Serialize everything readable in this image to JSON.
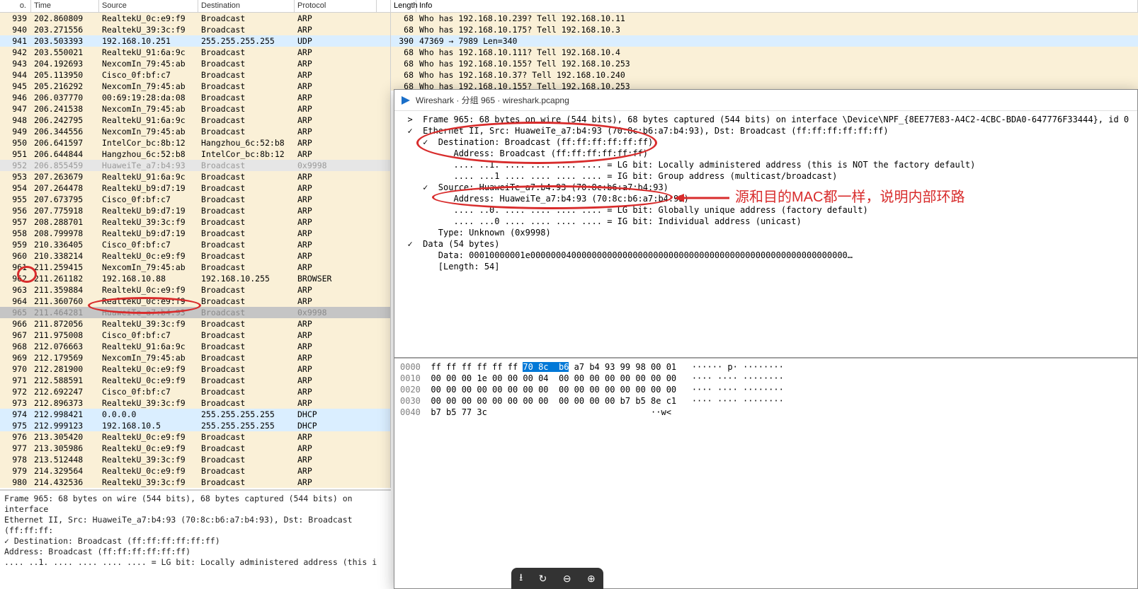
{
  "headers": {
    "no": "o.",
    "time": "Time",
    "src": "Source",
    "dst": "Destination",
    "proto": "Protocol",
    "len": "Length",
    "info": "Info"
  },
  "packets": [
    {
      "no": "939",
      "time": "202.860809",
      "src": "RealtekU_0c:e9:f9",
      "dst": "Broadcast",
      "proto": "ARP",
      "len": "68",
      "info": "Who has 192.168.10.239? Tell 192.168.10.11",
      "bg": "arp"
    },
    {
      "no": "940",
      "time": "203.271556",
      "src": "RealtekU_39:3c:f9",
      "dst": "Broadcast",
      "proto": "ARP",
      "len": "68",
      "info": "Who has 192.168.10.175? Tell 192.168.10.3",
      "bg": "arp"
    },
    {
      "no": "941",
      "time": "203.503393",
      "src": "192.168.10.251",
      "dst": "255.255.255.255",
      "proto": "UDP",
      "len": "390",
      "info": "47369 → 7989 Len=340",
      "bg": "udp"
    },
    {
      "no": "942",
      "time": "203.550021",
      "src": "RealtekU_91:6a:9c",
      "dst": "Broadcast",
      "proto": "ARP",
      "len": "68",
      "info": "Who has 192.168.10.111? Tell 192.168.10.4",
      "bg": "arp"
    },
    {
      "no": "943",
      "time": "204.192693",
      "src": "NexcomIn_79:45:ab",
      "dst": "Broadcast",
      "proto": "ARP",
      "len": "68",
      "info": "Who has 192.168.10.155? Tell 192.168.10.253",
      "bg": "arp"
    },
    {
      "no": "944",
      "time": "205.113950",
      "src": "Cisco_0f:bf:c7",
      "dst": "Broadcast",
      "proto": "ARP",
      "len": "68",
      "info": "Who has 192.168.10.37? Tell 192.168.10.240",
      "bg": "arp"
    },
    {
      "no": "945",
      "time": "205.216292",
      "src": "NexcomIn_79:45:ab",
      "dst": "Broadcast",
      "proto": "ARP",
      "len": "68",
      "info": "Who has 192.168.10.155? Tell 192.168.10.253",
      "bg": "arp"
    },
    {
      "no": "946",
      "time": "206.037770",
      "src": "00:69:19:28:da:08",
      "dst": "Broadcast",
      "proto": "ARP",
      "len": "",
      "info": "",
      "bg": "arp"
    },
    {
      "no": "947",
      "time": "206.241538",
      "src": "NexcomIn_79:45:ab",
      "dst": "Broadcast",
      "proto": "ARP",
      "len": "",
      "info": "",
      "bg": "arp"
    },
    {
      "no": "948",
      "time": "206.242795",
      "src": "RealtekU_91:6a:9c",
      "dst": "Broadcast",
      "proto": "ARP",
      "len": "",
      "info": "",
      "bg": "arp"
    },
    {
      "no": "949",
      "time": "206.344556",
      "src": "NexcomIn_79:45:ab",
      "dst": "Broadcast",
      "proto": "ARP",
      "len": "",
      "info": "",
      "bg": "arp"
    },
    {
      "no": "950",
      "time": "206.641597",
      "src": "IntelCor_bc:8b:12",
      "dst": "Hangzhou_6c:52:b8",
      "proto": "ARP",
      "len": "",
      "info": "",
      "bg": "arp"
    },
    {
      "no": "951",
      "time": "206.644844",
      "src": "Hangzhou_6c:52:b8",
      "dst": "IntelCor_bc:8b:12",
      "proto": "ARP",
      "len": "",
      "info": "",
      "bg": "arp"
    },
    {
      "no": "952",
      "time": "206.855459",
      "src": "HuaweiTe_a7:b4:93",
      "dst": "Broadcast",
      "proto": "0x9998",
      "len": "",
      "info": "",
      "bg": "gray"
    },
    {
      "no": "953",
      "time": "207.263679",
      "src": "RealtekU_91:6a:9c",
      "dst": "Broadcast",
      "proto": "ARP",
      "len": "",
      "info": "",
      "bg": "arp"
    },
    {
      "no": "954",
      "time": "207.264478",
      "src": "RealtekU_b9:d7:19",
      "dst": "Broadcast",
      "proto": "ARP",
      "len": "",
      "info": "",
      "bg": "arp"
    },
    {
      "no": "955",
      "time": "207.673795",
      "src": "Cisco_0f:bf:c7",
      "dst": "Broadcast",
      "proto": "ARP",
      "len": "",
      "info": "",
      "bg": "arp"
    },
    {
      "no": "956",
      "time": "207.775918",
      "src": "RealtekU_b9:d7:19",
      "dst": "Broadcast",
      "proto": "ARP",
      "len": "",
      "info": "",
      "bg": "arp"
    },
    {
      "no": "957",
      "time": "208.288701",
      "src": "RealtekU_39:3c:f9",
      "dst": "Broadcast",
      "proto": "ARP",
      "len": "",
      "info": "",
      "bg": "arp"
    },
    {
      "no": "958",
      "time": "208.799978",
      "src": "RealtekU_b9:d7:19",
      "dst": "Broadcast",
      "proto": "ARP",
      "len": "",
      "info": "",
      "bg": "arp"
    },
    {
      "no": "959",
      "time": "210.336405",
      "src": "Cisco_0f:bf:c7",
      "dst": "Broadcast",
      "proto": "ARP",
      "len": "",
      "info": "",
      "bg": "arp"
    },
    {
      "no": "960",
      "time": "210.338214",
      "src": "RealtekU_0c:e9:f9",
      "dst": "Broadcast",
      "proto": "ARP",
      "len": "",
      "info": "",
      "bg": "arp"
    },
    {
      "no": "961",
      "time": "211.259415",
      "src": "NexcomIn_79:45:ab",
      "dst": "Broadcast",
      "proto": "ARP",
      "len": "",
      "info": "",
      "bg": "arp"
    },
    {
      "no": "962",
      "time": "211.261182",
      "src": "192.168.10.88",
      "dst": "192.168.10.255",
      "proto": "BROWSER",
      "len": "",
      "info": "",
      "bg": "arp"
    },
    {
      "no": "963",
      "time": "211.359884",
      "src": "RealtekU_0c:e9:f9",
      "dst": "Broadcast",
      "proto": "ARP",
      "len": "",
      "info": "",
      "bg": "arp"
    },
    {
      "no": "964",
      "time": "211.360760",
      "src": "RealtekU_0c:e9:f9",
      "dst": "Broadcast",
      "proto": "ARP",
      "len": "",
      "info": "",
      "bg": "arp"
    },
    {
      "no": "965",
      "time": "211.464281",
      "src": "HuaweiTe_a7:b4:93",
      "dst": "Broadcast",
      "proto": "0x9998",
      "len": "",
      "info": "",
      "bg": "sel"
    },
    {
      "no": "966",
      "time": "211.872056",
      "src": "RealtekU_39:3c:f9",
      "dst": "Broadcast",
      "proto": "ARP",
      "len": "",
      "info": "",
      "bg": "arp"
    },
    {
      "no": "967",
      "time": "211.975008",
      "src": "Cisco_0f:bf:c7",
      "dst": "Broadcast",
      "proto": "ARP",
      "len": "",
      "info": "",
      "bg": "arp"
    },
    {
      "no": "968",
      "time": "212.076663",
      "src": "RealtekU_91:6a:9c",
      "dst": "Broadcast",
      "proto": "ARP",
      "len": "",
      "info": "",
      "bg": "arp"
    },
    {
      "no": "969",
      "time": "212.179569",
      "src": "NexcomIn_79:45:ab",
      "dst": "Broadcast",
      "proto": "ARP",
      "len": "",
      "info": "",
      "bg": "arp"
    },
    {
      "no": "970",
      "time": "212.281900",
      "src": "RealtekU_0c:e9:f9",
      "dst": "Broadcast",
      "proto": "ARP",
      "len": "",
      "info": "",
      "bg": "arp"
    },
    {
      "no": "971",
      "time": "212.588591",
      "src": "RealtekU_0c:e9:f9",
      "dst": "Broadcast",
      "proto": "ARP",
      "len": "",
      "info": "",
      "bg": "arp"
    },
    {
      "no": "972",
      "time": "212.692247",
      "src": "Cisco_0f:bf:c7",
      "dst": "Broadcast",
      "proto": "ARP",
      "len": "",
      "info": "",
      "bg": "arp"
    },
    {
      "no": "973",
      "time": "212.896373",
      "src": "RealtekU_39:3c:f9",
      "dst": "Broadcast",
      "proto": "ARP",
      "len": "",
      "info": "",
      "bg": "arp"
    },
    {
      "no": "974",
      "time": "212.998421",
      "src": "0.0.0.0",
      "dst": "255.255.255.255",
      "proto": "DHCP",
      "len": "",
      "info": "",
      "bg": "dhcp"
    },
    {
      "no": "975",
      "time": "212.999123",
      "src": "192.168.10.5",
      "dst": "255.255.255.255",
      "proto": "DHCP",
      "len": "",
      "info": "",
      "bg": "dhcp"
    },
    {
      "no": "976",
      "time": "213.305420",
      "src": "RealtekU_0c:e9:f9",
      "dst": "Broadcast",
      "proto": "ARP",
      "len": "",
      "info": "",
      "bg": "arp"
    },
    {
      "no": "977",
      "time": "213.305986",
      "src": "RealtekU_0c:e9:f9",
      "dst": "Broadcast",
      "proto": "ARP",
      "len": "",
      "info": "",
      "bg": "arp"
    },
    {
      "no": "978",
      "time": "213.512448",
      "src": "RealtekU_39:3c:f9",
      "dst": "Broadcast",
      "proto": "ARP",
      "len": "",
      "info": "",
      "bg": "arp"
    },
    {
      "no": "979",
      "time": "214.329564",
      "src": "RealtekU_0c:e9:f9",
      "dst": "Broadcast",
      "proto": "ARP",
      "len": "",
      "info": "",
      "bg": "arp"
    },
    {
      "no": "980",
      "time": "214.432536",
      "src": "RealtekU_39:3c:f9",
      "dst": "Broadcast",
      "proto": "ARP",
      "len": "",
      "info": "",
      "bg": "arp"
    }
  ],
  "bottom_detail": {
    "l1": "Frame 965: 68 bytes on wire (544 bits), 68 bytes captured (544 bits) on interface",
    "l2": "Ethernet II, Src: HuaweiTe_a7:b4:93 (70:8c:b6:a7:b4:93), Dst: Broadcast (ff:ff:ff:",
    "l3": "✓ Destination: Broadcast (ff:ff:ff:ff:ff:ff)",
    "l4": "    Address: Broadcast (ff:ff:ff:ff:ff:ff)",
    "l5": "    .... ..1. .... .... .... .... = LG bit: Locally administered address (this i"
  },
  "dialog": {
    "title": "Wireshark · 分组 965 · wireshark.pcapng",
    "tree": {
      "l1": "  >  Frame 965: 68 bytes on wire (544 bits), 68 bytes captured (544 bits) on interface \\Device\\NPF_{8EE77E83-A4C2-4CBC-BDA0-647776F33444}, id 0",
      "l2": "  ✓  Ethernet II, Src: HuaweiTe_a7:b4:93 (70:8c:b6:a7:b4:93), Dst: Broadcast (ff:ff:ff:ff:ff:ff)",
      "l3": "     ✓  Destination: Broadcast (ff:ff:ff:ff:ff:ff)",
      "l4": "           Address: Broadcast (ff:ff:ff:ff:ff:ff)",
      "l5": "           .... ..1. .... .... .... .... = LG bit: Locally administered address (this is NOT the factory default)",
      "l6": "           .... ...1 .... .... .... .... = IG bit: Group address (multicast/broadcast)",
      "l7": "     ✓  Source: HuaweiTe_a7:b4:93 (70:8c:b6:a7:b4:93)",
      "l8": "           Address: HuaweiTe_a7:b4:93 (70:8c:b6:a7:b4:93)",
      "l9": "           .... ..0. .... .... .... .... = LG bit: Globally unique address (factory default)",
      "l10": "           .... ...0 .... .... .... .... = IG bit: Individual address (unicast)",
      "l11": "        Type: Unknown (0x9998)",
      "l12": "  ✓  Data (54 bytes)",
      "l13": "        Data: 00010000001e00000004000000000000000000000000000000000000000000000000000000…",
      "l14": "        [Length: 54]"
    },
    "hex": {
      "r0": {
        "off": "0000",
        "b1": "ff ff ff ff ff ff ",
        "sel": "70 8c  b6",
        "b2": " a7 b4 93 99 98 00 01",
        "asc": "   ······ p· ········"
      },
      "r1": {
        "off": "0010",
        "b1": "00 00 00 1e 00 00 00 04  00 00 00 00 00 00 00 00",
        "asc": "   ···· ···· ········"
      },
      "r2": {
        "off": "0020",
        "b1": "00 00 00 00 00 00 00 00  00 00 00 00 00 00 00 00",
        "asc": "   ···· ···· ········"
      },
      "r3": {
        "off": "0030",
        "b1": "00 00 00 00 00 00 00 00  00 00 00 00 b7 b5 8e c1",
        "asc": "   ···· ···· ········"
      },
      "r4": {
        "off": "0040",
        "b1": "b7 b5 77 3c",
        "asc": "                                ··w<"
      }
    }
  },
  "annotation_text": "源和目的MAC都一样，说明内部环路"
}
